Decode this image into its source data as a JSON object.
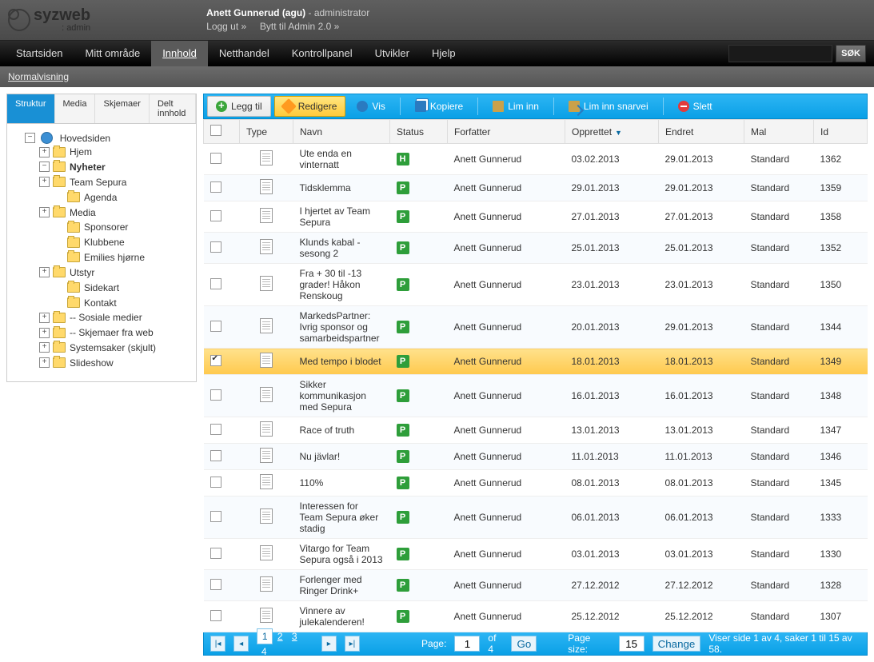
{
  "brand": {
    "name": "syzweb",
    "sub": ": admin"
  },
  "user": {
    "name": "Anett Gunnerud (agu)",
    "role": "administrator",
    "logout": "Logg ut »",
    "switch": "Bytt til Admin 2.0 »"
  },
  "mainnav": {
    "items": [
      "Startsiden",
      "Mitt område",
      "Innhold",
      "Netthandel",
      "Kontrollpanel",
      "Utvikler",
      "Hjelp"
    ],
    "active": 2,
    "search_button": "SØK"
  },
  "subnav": {
    "link": "Normalvisning"
  },
  "sidebar": {
    "tabs": [
      "Struktur",
      "Media",
      "Skjemaer",
      "Delt innhold"
    ],
    "active_tab": 0,
    "root": "Hovedsiden",
    "nodes": [
      {
        "label": "Hjem",
        "exp": "+",
        "depth": 1
      },
      {
        "label": "Nyheter",
        "exp": "-",
        "depth": 1,
        "bold": true
      },
      {
        "label": "Team Sepura",
        "exp": "+",
        "depth": 1
      },
      {
        "label": "Agenda",
        "exp": "",
        "depth": 2
      },
      {
        "label": "Media",
        "exp": "+",
        "depth": 1
      },
      {
        "label": "Sponsorer",
        "exp": "",
        "depth": 2
      },
      {
        "label": "Klubbene",
        "exp": "",
        "depth": 2
      },
      {
        "label": "Emilies hjørne",
        "exp": "",
        "depth": 2
      },
      {
        "label": "Utstyr",
        "exp": "+",
        "depth": 1
      },
      {
        "label": "Sidekart",
        "exp": "",
        "depth": 2
      },
      {
        "label": "Kontakt",
        "exp": "",
        "depth": 2
      },
      {
        "label": "-- Sosiale medier",
        "exp": "+",
        "depth": 1
      },
      {
        "label": "-- Skjemaer fra web",
        "exp": "+",
        "depth": 1
      },
      {
        "label": "Systemsaker (skjult)",
        "exp": "+",
        "depth": 1
      },
      {
        "label": "Slideshow",
        "exp": "+",
        "depth": 1
      }
    ]
  },
  "toolbar": {
    "add": "Legg til",
    "edit": "Redigere",
    "view": "Vis",
    "copy": "Kopiere",
    "paste": "Lim inn",
    "paste_shortcut": "Lim inn snarvei",
    "delete": "Slett"
  },
  "grid": {
    "headers": {
      "type": "Type",
      "name": "Navn",
      "status": "Status",
      "author": "Forfatter",
      "created": "Opprettet",
      "modified": "Endret",
      "template": "Mal",
      "id": "Id"
    },
    "sort_col": "created",
    "sort_dir": "desc",
    "rows": [
      {
        "sel": false,
        "name": "Ute enda en vinternatt",
        "status": "H",
        "author": "Anett Gunnerud",
        "created": "03.02.2013",
        "modified": "29.01.2013",
        "template": "Standard",
        "id": "1362"
      },
      {
        "sel": false,
        "name": "Tidsklemma",
        "status": "P",
        "author": "Anett Gunnerud",
        "created": "29.01.2013",
        "modified": "29.01.2013",
        "template": "Standard",
        "id": "1359"
      },
      {
        "sel": false,
        "name": "I hjertet av Team Sepura",
        "status": "P",
        "author": "Anett Gunnerud",
        "created": "27.01.2013",
        "modified": "27.01.2013",
        "template": "Standard",
        "id": "1358"
      },
      {
        "sel": false,
        "name": "Klunds kabal - sesong 2",
        "status": "P",
        "author": "Anett Gunnerud",
        "created": "25.01.2013",
        "modified": "25.01.2013",
        "template": "Standard",
        "id": "1352"
      },
      {
        "sel": false,
        "name": "Fra + 30 til -13 grader! Håkon Renskoug",
        "status": "P",
        "author": "Anett Gunnerud",
        "created": "23.01.2013",
        "modified": "23.01.2013",
        "template": "Standard",
        "id": "1350"
      },
      {
        "sel": false,
        "name": "MarkedsPartner: Ivrig sponsor og samarbeidspartner",
        "status": "P",
        "author": "Anett Gunnerud",
        "created": "20.01.2013",
        "modified": "29.01.2013",
        "template": "Standard",
        "id": "1344"
      },
      {
        "sel": true,
        "name": "Med tempo i blodet",
        "status": "P",
        "author": "Anett Gunnerud",
        "created": "18.01.2013",
        "modified": "18.01.2013",
        "template": "Standard",
        "id": "1349"
      },
      {
        "sel": false,
        "name": "Sikker kommunikasjon med Sepura",
        "status": "P",
        "author": "Anett Gunnerud",
        "created": "16.01.2013",
        "modified": "16.01.2013",
        "template": "Standard",
        "id": "1348"
      },
      {
        "sel": false,
        "name": "Race of truth",
        "status": "P",
        "author": "Anett Gunnerud",
        "created": "13.01.2013",
        "modified": "13.01.2013",
        "template": "Standard",
        "id": "1347"
      },
      {
        "sel": false,
        "name": "Nu jävlar!",
        "status": "P",
        "author": "Anett Gunnerud",
        "created": "11.01.2013",
        "modified": "11.01.2013",
        "template": "Standard",
        "id": "1346"
      },
      {
        "sel": false,
        "name": "110%",
        "status": "P",
        "author": "Anett Gunnerud",
        "created": "08.01.2013",
        "modified": "08.01.2013",
        "template": "Standard",
        "id": "1345"
      },
      {
        "sel": false,
        "name": "Interessen for Team Sepura øker stadig",
        "status": "P",
        "author": "Anett Gunnerud",
        "created": "06.01.2013",
        "modified": "06.01.2013",
        "template": "Standard",
        "id": "1333"
      },
      {
        "sel": false,
        "name": "Vitargo for Team Sepura også i 2013",
        "status": "P",
        "author": "Anett Gunnerud",
        "created": "03.01.2013",
        "modified": "03.01.2013",
        "template": "Standard",
        "id": "1330"
      },
      {
        "sel": false,
        "name": "Forlenger med Ringer Drink+",
        "status": "P",
        "author": "Anett Gunnerud",
        "created": "27.12.2012",
        "modified": "27.12.2012",
        "template": "Standard",
        "id": "1328"
      },
      {
        "sel": false,
        "name": "Vinnere av julekalenderen!",
        "status": "P",
        "author": "Anett Gunnerud",
        "created": "25.12.2012",
        "modified": "25.12.2012",
        "template": "Standard",
        "id": "1307"
      }
    ]
  },
  "pager": {
    "pages": [
      1,
      2,
      3,
      4
    ],
    "current": 1,
    "total": 4,
    "page_label": "Page:",
    "of_label": "of",
    "go": "Go",
    "size_label": "Page size:",
    "size": "15",
    "change": "Change",
    "info": "Viser side 1 av 4, saker 1 til 15 av 58.",
    "page_input": "1"
  }
}
